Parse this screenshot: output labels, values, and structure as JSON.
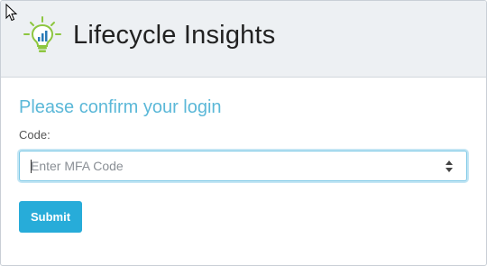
{
  "header": {
    "title": "Lifecycle Insights",
    "logo_icon": "lightbulb-chart-icon"
  },
  "form": {
    "heading": "Please confirm your login",
    "code_label": "Code:",
    "code_input": {
      "value": "",
      "placeholder": "Enter MFA Code"
    },
    "submit_label": "Submit"
  },
  "colors": {
    "heading": "#5bb8d8",
    "button": "#27acd9",
    "header_bg": "#edf0f3",
    "logo_green": "#8dc63f",
    "logo_blue": "#2a7ab8"
  }
}
